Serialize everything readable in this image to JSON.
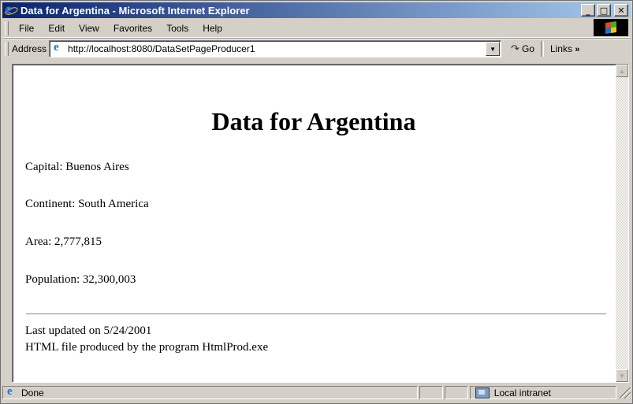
{
  "window": {
    "title": "Data for Argentina - Microsoft Internet Explorer",
    "minimize_glyph": "_",
    "maximize_glyph": "□",
    "close_glyph": "✕"
  },
  "menu": {
    "items": [
      "File",
      "Edit",
      "View",
      "Favorites",
      "Tools",
      "Help"
    ]
  },
  "address_bar": {
    "label": "Address",
    "url": "http://localhost:8080/DataSetPageProducer1",
    "go_label": "Go",
    "links_label": "Links",
    "links_more": "»"
  },
  "page": {
    "title": "Data for Argentina",
    "capital": "Capital: Buenos Aires",
    "continent": "Continent: South America",
    "area": "Area: 2,777,815",
    "population": "Population: 32,300,003",
    "last_updated": "Last updated on 5/24/2001",
    "produced_by": "HTML file produced by the program HtmlProd.exe"
  },
  "status_bar": {
    "status_text": "Done",
    "zone_text": "Local intranet"
  },
  "icons": {
    "browser": "ie-logo-icon",
    "page": "page-icon",
    "go": "go-arrow-icon",
    "zone": "local-intranet-icon"
  },
  "colors": {
    "titlebar_start": "#0a246a",
    "titlebar_end": "#a6caf0",
    "chrome": "#d4d0c8",
    "ie_blue": "#1f6fd8"
  }
}
